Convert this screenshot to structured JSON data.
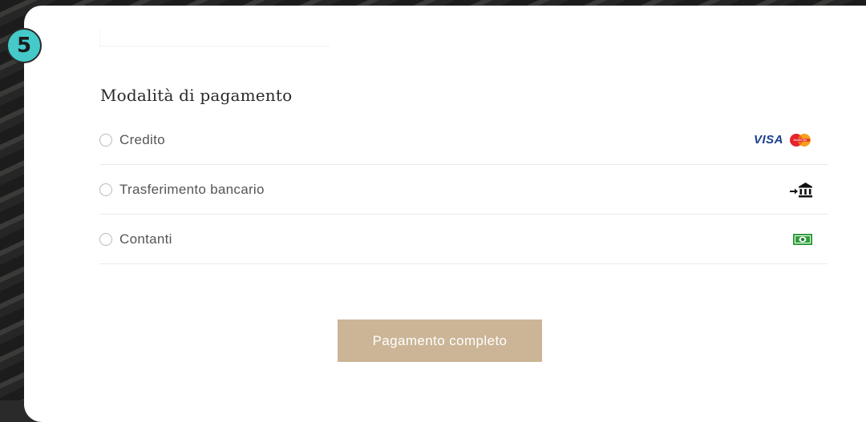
{
  "step": {
    "number": "5"
  },
  "payment": {
    "title": "Modalità di pagamento",
    "options": [
      {
        "label": "Credito",
        "icon": "visa-mastercard-icon",
        "brand_text": "VISA",
        "mastercard_text": "MasterCard"
      },
      {
        "label": "Trasferimento bancario",
        "icon": "bank-transfer-icon"
      },
      {
        "label": "Contanti",
        "icon": "cash-icon"
      }
    ],
    "submit_label": "Pagamento completo"
  },
  "colors": {
    "badge": "#45c9c9",
    "button": "#cbb596",
    "visa_blue": "#1a3f8f",
    "mastercard_red": "#e4252e",
    "mastercard_orange": "#f7a01d",
    "cash_green": "#2e9e3a"
  }
}
